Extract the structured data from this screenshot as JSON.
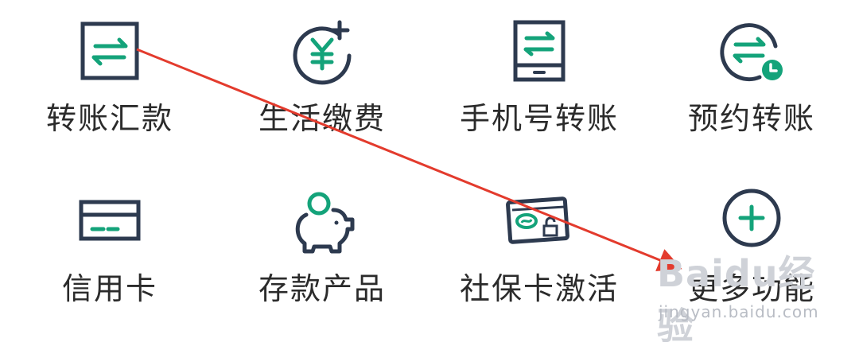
{
  "colors": {
    "icon_stroke": "#2d3a4f",
    "accent": "#14a37a",
    "arrow": "#e33b2d",
    "label": "#2b2b2b"
  },
  "tiles": [
    {
      "label": "转账汇款",
      "icon": "transfer-icon"
    },
    {
      "label": "生活缴费",
      "icon": "yuan-plus-icon"
    },
    {
      "label": "手机号转账",
      "icon": "phone-transfer-icon"
    },
    {
      "label": "预约转账",
      "icon": "scheduled-transfer-icon"
    },
    {
      "label": "信用卡",
      "icon": "credit-card-icon"
    },
    {
      "label": "存款产品",
      "icon": "piggy-bank-icon"
    },
    {
      "label": "社保卡激活",
      "icon": "social-security-card-icon"
    },
    {
      "label": "更多功能",
      "icon": "plus-circle-icon"
    }
  ],
  "watermark": {
    "brand": "Baidu经验",
    "domain": "jingyan.baidu.com"
  }
}
